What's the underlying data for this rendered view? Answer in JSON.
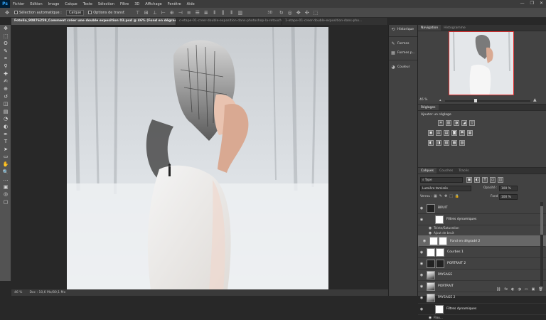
{
  "app": {
    "logo": "Ps"
  },
  "menu": [
    "Fichier",
    "Edition",
    "Image",
    "Calque",
    "Texte",
    "Sélection",
    "Filtre",
    "3D",
    "Affichage",
    "Fenêtre",
    "Aide"
  ],
  "window_controls": [
    "—",
    "❐",
    "✕"
  ],
  "options_bar": {
    "auto_select_label": "Sélection automatique :",
    "auto_select_target": "Calque",
    "transform_label": "Options de transf."
  },
  "tabs": [
    {
      "label": "Fotolia_90876259_Comment créer une double exposition 03.psd @ 46% (Fond en dégradé 2, RVB/8)",
      "active": true
    },
    {
      "label": "c-etape-01-creer-double-exposition-dans-photoshop-la-retouche-photo.JPG @ 50% (RVB/8)",
      "active": false
    },
    {
      "label": "1-etape-01-creer-double-exposition-dans-pho...",
      "active": false
    }
  ],
  "tools": [
    "move-icon",
    "marquee-icon",
    "lasso-icon",
    "quick-select-icon",
    "crop-icon",
    "eyedropper-icon",
    "healing-icon",
    "brush-icon",
    "stamp-icon",
    "history-brush-icon",
    "eraser-icon",
    "gradient-icon",
    "blur-icon",
    "dodge-icon",
    "pen-icon",
    "type-icon",
    "path-select-icon",
    "rectangle-icon",
    "hand-icon",
    "zoom-icon",
    "more-icon",
    "colors-icon",
    "quickmask-icon",
    "screenmode-icon"
  ],
  "tool_glyphs": [
    "✥",
    "⬚",
    "ʘ",
    "✎",
    "⌗",
    "⚲",
    "✚",
    "✍",
    "⊕",
    "↺",
    "◫",
    "▤",
    "◔",
    "◐",
    "✒",
    "T",
    "➤",
    "▭",
    "✋",
    "🔍",
    "…",
    "▣",
    "◎",
    "▢"
  ],
  "status": {
    "zoom": "46 %",
    "doc": "Doc : 10,6 Mo/80,1 Mo"
  },
  "strip": [
    {
      "icon": "history-icon",
      "glyph": "⟲",
      "label": "Historique"
    },
    {
      "icon": "brush-panel-icon",
      "glyph": "✎",
      "label": "Formes"
    },
    {
      "icon": "brush-presets-icon",
      "glyph": "▦",
      "label": "Formes p..."
    },
    {
      "icon": "color-icon",
      "glyph": "◕",
      "label": "Couleur"
    }
  ],
  "navigator": {
    "tabs": [
      "Navigation",
      "Histogramme"
    ],
    "zoom": "46 %",
    "slider_fraction": 0.35
  },
  "adjustments": {
    "tab": "Réglages",
    "title": "Ajouter un réglage",
    "row1": [
      "☀",
      "▥",
      "◑",
      "◢",
      "▽"
    ],
    "row2": [
      "▣",
      "⚖",
      "▤",
      "◙",
      "⬒",
      "▦"
    ],
    "row3": [
      "◧",
      "◨",
      "▧",
      "▩",
      "▨"
    ]
  },
  "layers_panel": {
    "tabs": [
      "Calques",
      "Couches",
      "Tracés"
    ],
    "kind": "Type",
    "blend_mode": "Lumière tamisée",
    "opacity_label": "Opacité :",
    "opacity": "100 %",
    "lock_label": "Verrou :",
    "fill_label": "Fond :",
    "fill": "100 %",
    "layers": [
      {
        "name": "BRUIT",
        "type": "group",
        "thumb": "dark"
      },
      {
        "name": "Filtres dynamiques",
        "type": "filter",
        "thumb": "white"
      },
      {
        "name": "Teinte/Saturation",
        "type": "sub"
      },
      {
        "name": "Ajout de bruit",
        "type": "sub"
      },
      {
        "name": "Fond en dégradé 2",
        "type": "layer",
        "thumb": "white",
        "selected": true
      },
      {
        "name": "Courbes 1",
        "type": "layer",
        "thumb": "white"
      },
      {
        "name": "PORTRAIT 2",
        "type": "layer",
        "thumb": "dark"
      },
      {
        "name": "PAYSAGE",
        "type": "layer",
        "thumb": "photo"
      },
      {
        "name": "PORTRAIT",
        "type": "layer",
        "thumb": "photo"
      },
      {
        "name": "PAYSAGE 2",
        "type": "layer",
        "thumb": "photo"
      },
      {
        "name": "Filtres dynamiques",
        "type": "filter",
        "thumb": "white"
      },
      {
        "name": "Flou...",
        "type": "sub"
      }
    ],
    "footer": [
      "⛓",
      "fx",
      "◐",
      "◑",
      "▭",
      "▣",
      "🗑"
    ]
  }
}
